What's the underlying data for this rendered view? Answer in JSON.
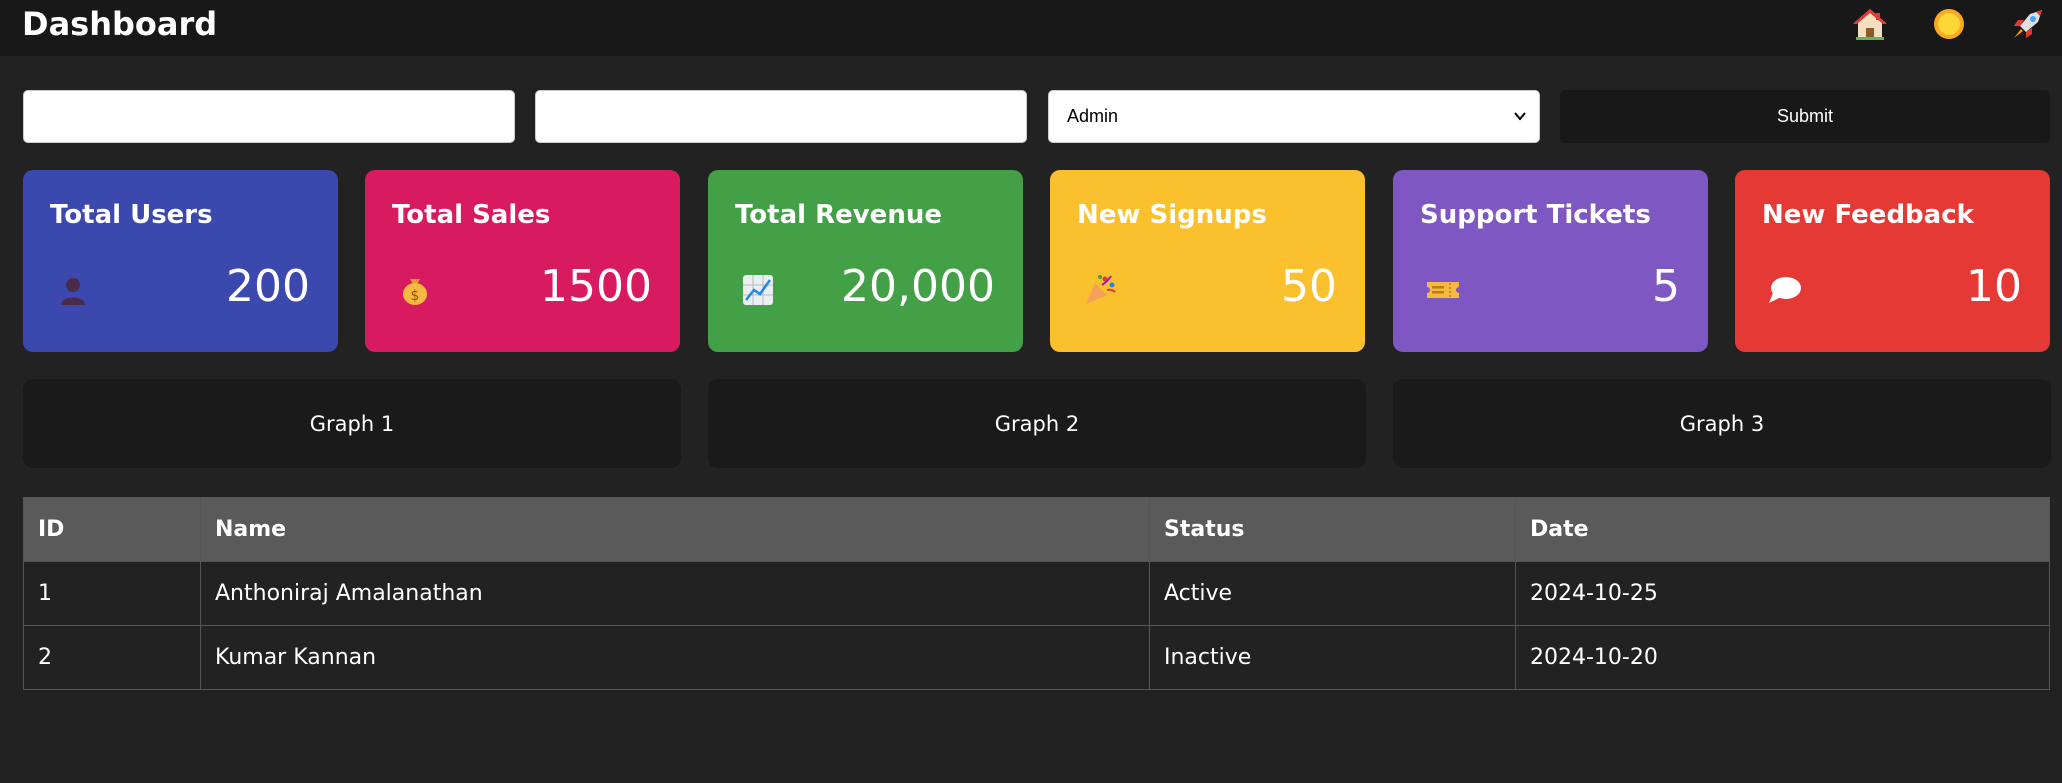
{
  "header": {
    "title": "Dashboard",
    "icons": [
      "home-icon",
      "sun-icon",
      "rocket-icon"
    ]
  },
  "form": {
    "input1_value": "",
    "input2_value": "",
    "select_value": "Admin",
    "submit_label": "Submit"
  },
  "cards": [
    {
      "title": "Total Users",
      "value": "200",
      "icon": "user-icon",
      "color": "#3b48ad"
    },
    {
      "title": "Total Sales",
      "value": "1500",
      "icon": "money-bag-icon",
      "color": "#d81b60"
    },
    {
      "title": "Total Revenue",
      "value": "20,000",
      "icon": "chart-increasing-icon",
      "color": "#43a047"
    },
    {
      "title": "New Signups",
      "value": "50",
      "icon": "party-popper-icon",
      "color": "#fbc02d"
    },
    {
      "title": "Support Tickets",
      "value": "5",
      "icon": "ticket-icon",
      "color": "#7e57c2"
    },
    {
      "title": "New Feedback",
      "value": "10",
      "icon": "speech-bubble-icon",
      "color": "#e53935"
    }
  ],
  "graphs": [
    {
      "label": "Graph 1"
    },
    {
      "label": "Graph 2"
    },
    {
      "label": "Graph 3"
    }
  ],
  "table": {
    "headers": [
      "ID",
      "Name",
      "Status",
      "Date"
    ],
    "rows": [
      [
        "1",
        "Anthoniraj Amalanathan",
        "Active",
        "2024-10-25"
      ],
      [
        "2",
        "Kumar Kannan",
        "Inactive",
        "2024-10-20"
      ]
    ]
  }
}
